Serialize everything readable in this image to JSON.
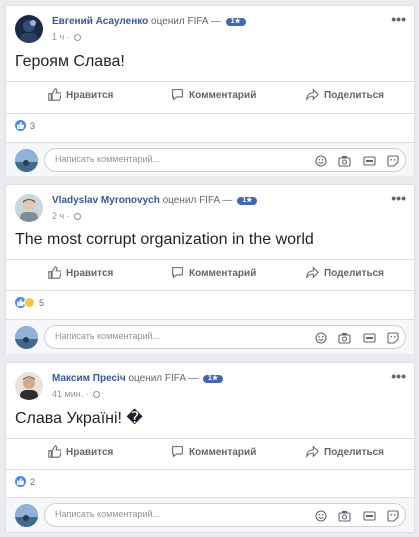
{
  "posts": [
    {
      "author": "Евгений Асауленко",
      "verb": "оценил",
      "page": "FIFA",
      "dash": "—",
      "chip": "1★",
      "time": "1 ч",
      "text": "Героям Слава!",
      "reaction_count": "3",
      "reactions": [
        "like"
      ],
      "comment_placeholder": "Написать комментарий..."
    },
    {
      "author": "Vladyslav Myronovych",
      "verb": "оценил",
      "page": "FIFA",
      "dash": "—",
      "chip": "1★",
      "time": "2 ч",
      "text": "The most corrupt organization in the world",
      "reaction_count": "5",
      "reactions": [
        "like",
        "wow"
      ],
      "comment_placeholder": "Написать комментарий..."
    },
    {
      "author": "Максим Пресіч",
      "verb": "оценил",
      "page": "FIFA",
      "dash": "—",
      "chip": "1★",
      "time": "41 мин.",
      "text": "Слава Україні! �",
      "reaction_count": "2",
      "reactions": [
        "like"
      ],
      "comment_placeholder": "Написать комментарий..."
    }
  ],
  "actions": {
    "like": "Нравится",
    "comment": "Комментарий",
    "share": "Поделиться"
  },
  "separator": "·",
  "more": "•••",
  "colors": {
    "link": "#365899",
    "chip": "#4267b2",
    "like": "#4a88f0",
    "wow": "#f7c43a",
    "background": "#e9ebee"
  },
  "icons": [
    "globe-icon",
    "thumbs-up-icon",
    "comment-bubble-icon",
    "share-arrow-icon",
    "emoji-icon",
    "camera-icon",
    "gif-icon",
    "sticker-icon",
    "more-dots-icon"
  ]
}
